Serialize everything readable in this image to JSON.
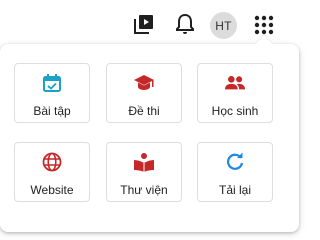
{
  "header": {
    "video_icon": "video-library-icon",
    "bell_icon": "notifications-icon",
    "avatar_initials": "HT",
    "apps_icon": "apps-grid-icon"
  },
  "apps_menu": {
    "items": [
      {
        "label": "Bài tập",
        "icon": "assignment-calendar-icon",
        "color": "#1aa3c7"
      },
      {
        "label": "Đề thi",
        "icon": "graduation-cap-icon",
        "color": "#c62828"
      },
      {
        "label": "Học sinh",
        "icon": "people-icon",
        "color": "#c62828"
      },
      {
        "label": "Website",
        "icon": "globe-icon",
        "color": "#c62828"
      },
      {
        "label": "Thư viện",
        "icon": "book-reader-icon",
        "color": "#c62828"
      },
      {
        "label": "Tải lại",
        "icon": "refresh-icon",
        "color": "#1e88e5"
      }
    ]
  },
  "colors": {
    "icon_gray": "#1f1f1f",
    "avatar_bg": "#dcdcdc",
    "tile_border": "#dedede"
  }
}
